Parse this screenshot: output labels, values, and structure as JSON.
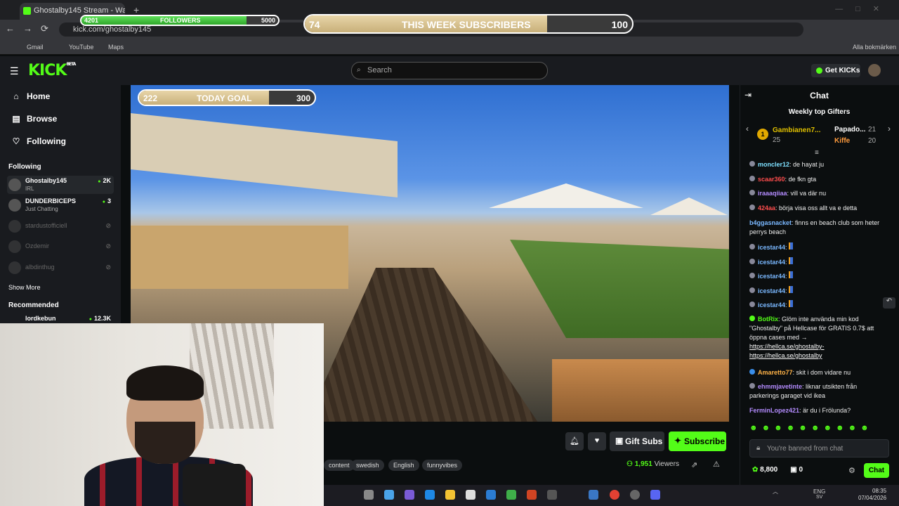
{
  "browser": {
    "tab_title": "Ghostalby145 Stream - Wat",
    "new_tab": "+",
    "url": "kick.com/ghostalby145",
    "bookmarks": [
      "Gmail",
      "YouTube",
      "Maps"
    ],
    "all_bookmarks": "Alla bokmärken"
  },
  "overlays": {
    "followers": {
      "current": "4201",
      "label": "FOLLOWERS",
      "target": "5000",
      "progress": 0.84
    },
    "week_subs": {
      "current": "74",
      "label": "THIS WEEK SUBSCRIBERS",
      "target": "100",
      "progress": 0.74
    },
    "today_goal": {
      "current": "222",
      "label": "TODAY GOAL",
      "target": "300",
      "progress": 0.74
    }
  },
  "header": {
    "logo": "KICK",
    "logo_sup": "BETA",
    "search_placeholder": "Search",
    "get_kicks": "Get KICKs"
  },
  "sidebar": {
    "nav": [
      {
        "label": "Home",
        "icon": "home-icon"
      },
      {
        "label": "Browse",
        "icon": "browse-icon"
      },
      {
        "label": "Following",
        "icon": "heart-icon"
      }
    ],
    "following_title": "Following",
    "channels": [
      {
        "name": "Ghostalby145",
        "sub": "IRL",
        "count": "2K",
        "live": true
      },
      {
        "name": "DUNDERBICEPS",
        "sub": "Just Chatting",
        "count": "3",
        "live": true
      },
      {
        "name": "stardustofficiell",
        "live": false
      },
      {
        "name": "Ozdemir",
        "live": false
      },
      {
        "name": "albdinthug",
        "live": false
      }
    ],
    "show_more": "Show More",
    "recommended_title": "Recommended",
    "recommended": [
      {
        "name": "lordkebun",
        "count": "12.3K"
      }
    ]
  },
  "stream": {
    "gift_subs": "Gift Subs",
    "subscribe": "Subscribe",
    "tags": [
      "content",
      "swedish",
      "English",
      "funnyvibes"
    ],
    "viewers": "1,951",
    "viewers_label": "Viewers"
  },
  "chat": {
    "title": "Chat",
    "top_gifters_title": "Weekly top Gifters",
    "gifters": [
      {
        "rank": "1",
        "name": "Gambianen7...",
        "count": "25"
      },
      {
        "name": "Papado...",
        "count": "21"
      },
      {
        "name": "Kiffe",
        "count": "20"
      }
    ],
    "messages": [
      {
        "user": "moncler12",
        "text": "de hayat ju",
        "color": "#7ee0ff"
      },
      {
        "user": "scaar360",
        "text": "de fkn gta",
        "color": "#ff4d4d"
      },
      {
        "user": "iraaaqiiaa",
        "text": "vill va där nu",
        "color": "#b48cff"
      },
      {
        "user": "424aa",
        "text": "börja visa oss allt va e detta",
        "color": "#ff4d4d"
      },
      {
        "user": "b4ggasnacket",
        "text": "finns en beach club som heter perrys beach",
        "color": "#7ab8ff"
      },
      {
        "user": "icestar44",
        "text": "",
        "color": "#7ab8ff"
      },
      {
        "user": "icestar44",
        "text": "",
        "color": "#7ab8ff"
      },
      {
        "user": "icestar44",
        "text": "",
        "color": "#7ab8ff"
      },
      {
        "user": "icestar44",
        "text": "",
        "color": "#7ab8ff"
      },
      {
        "user": "icestar44",
        "text": "",
        "color": "#7ab8ff"
      },
      {
        "user": "BotRix",
        "text": "Glöm inte använda min kod \"Ghostalby\" på Hellcase för GRATIS 0.7$ att öppna cases med →",
        "color": "#53fc18"
      },
      {
        "user": "Amaretto77",
        "text": "skit i dom vidare nu",
        "color": "#ffb347"
      },
      {
        "user": "ehmmjavetinte",
        "text": "liknar utsikten från parkerings garaget vid ikea",
        "color": "#b48cff"
      },
      {
        "user": "FerminLopez421",
        "text": "är du i Frölunda?",
        "color": "#b48cff"
      }
    ],
    "links": [
      "https://hellca.se/ghostalby-",
      "https://hellca.se/ghostalby"
    ],
    "banned_text": "You're banned from chat",
    "kicks_balance": "8,800",
    "gift_count": "0",
    "chat_button": "Chat"
  },
  "taskbar": {
    "lang": "ENG",
    "lang2": "SV",
    "time": "08:35",
    "date": "07/04/2026"
  }
}
